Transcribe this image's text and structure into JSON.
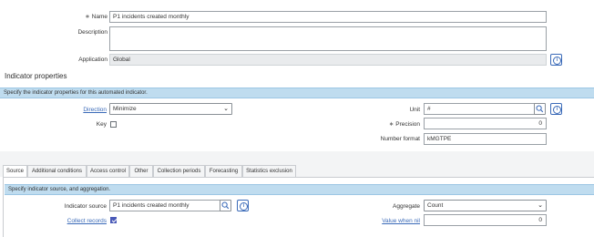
{
  "form": {
    "name_label": "Name",
    "name_value": "P1 incidents created monthly",
    "description_label": "Description",
    "description_value": "",
    "application_label": "Application",
    "application_value": "Global",
    "required_mark": "∗"
  },
  "indicator_properties": {
    "section_title": "Indicator properties",
    "banner": "Specify the indicator properties for this automated indicator.",
    "direction_label": "Direction",
    "direction_value": "Minimize",
    "key_label": "Key",
    "key_checked": false,
    "unit_label": "Unit",
    "unit_value": "#",
    "precision_label": "Precision",
    "precision_value": "0",
    "number_format_label": "Number format",
    "number_format_value": "kMGTPE"
  },
  "tabs": [
    {
      "label": "Source",
      "active": true
    },
    {
      "label": "Additional conditions",
      "active": false
    },
    {
      "label": "Access control",
      "active": false
    },
    {
      "label": "Other",
      "active": false
    },
    {
      "label": "Collection periods",
      "active": false
    },
    {
      "label": "Forecasting",
      "active": false
    },
    {
      "label": "Statistics exclusion",
      "active": false
    }
  ],
  "source": {
    "banner": "Specify indicator source, and aggregation.",
    "indicator_source_label": "Indicator source",
    "indicator_source_value": "P1 incidents created monthly",
    "aggregate_label": "Aggregate",
    "aggregate_value": "Count",
    "collect_records_label": "Collect records",
    "collect_records_checked": true,
    "value_when_nil_label": "Value when nil",
    "value_when_nil_value": "0"
  },
  "icons": {
    "search": "search-icon",
    "info": "info-icon",
    "chevron": "chevron-down-icon"
  },
  "colors": {
    "banner_bg": "#bfdcef",
    "link": "#3a6ab8",
    "checkbox_checked": "#4a5ab8"
  }
}
